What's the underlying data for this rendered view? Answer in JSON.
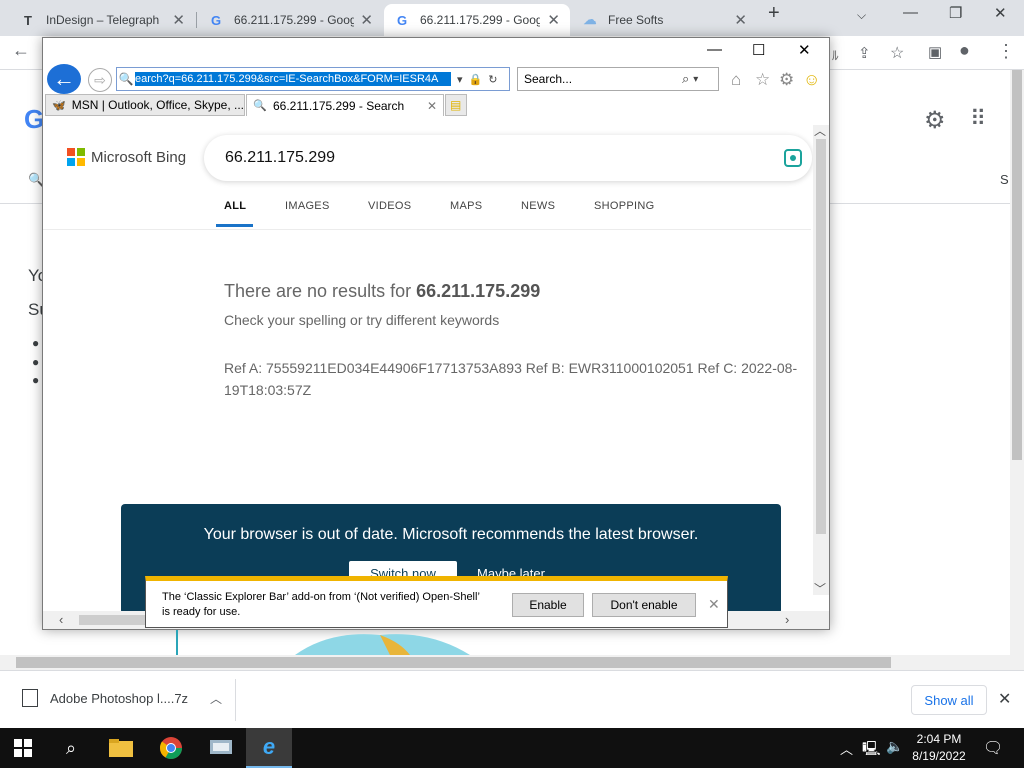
{
  "chrome": {
    "tabs": [
      {
        "favicon": "T",
        "title": "InDesign – Telegraph"
      },
      {
        "favicon": "G",
        "title": "66.211.175.299 - Goog"
      },
      {
        "favicon": "G",
        "title": "66.211.175.299 - Goog"
      },
      {
        "favicon": "cloud-icon",
        "title": "Free Softs"
      }
    ],
    "google_partial": {
      "left_letter": "G",
      "text1": "Yo",
      "text2": "Su",
      "right_letter": "S"
    }
  },
  "ie": {
    "address_url": "earch?q=66.211.175.299&src=IE-SearchBox&FORM=IESR4A",
    "search_placeholder": "Search...",
    "tabs": [
      {
        "title": "MSN | Outlook, Office, Skype, ..."
      },
      {
        "title": "66.211.175.299 - Search"
      }
    ],
    "bing": {
      "logo_text": "Microsoft Bing",
      "query": "66.211.175.299",
      "nav": [
        "ALL",
        "IMAGES",
        "VIDEOS",
        "MAPS",
        "NEWS",
        "SHOPPING"
      ],
      "no_results_prefix": "There are no results for ",
      "no_results_query": "66.211.175.299",
      "hint": "Check your spelling or try different keywords",
      "ref": "Ref A: 75559211ED034E44906F17713753A893 Ref B: EWR311000102051 Ref C: 2022-08-19T18:03:57Z"
    },
    "banner": {
      "text": "Your browser is out of date. Microsoft recommends the latest browser.",
      "primary": "Switch now",
      "secondary": "Maybe later"
    },
    "notification": {
      "text": "The ‘Classic Explorer Bar’ add-on from ‘(Not verified) Open-Shell’ is ready for use.",
      "enable": "Enable",
      "dont_enable": "Don't enable"
    }
  },
  "downloads": {
    "file": "Adobe Photoshop l....7z",
    "show_all": "Show all"
  },
  "taskbar": {
    "time": "2:04 PM",
    "date": "8/19/2022"
  },
  "colors": {
    "ie_blue": "#1d6fd6",
    "banner_bg": "#0b3d57",
    "notif_accent": "#f0b400",
    "bing_underline": "#1a73c8"
  }
}
